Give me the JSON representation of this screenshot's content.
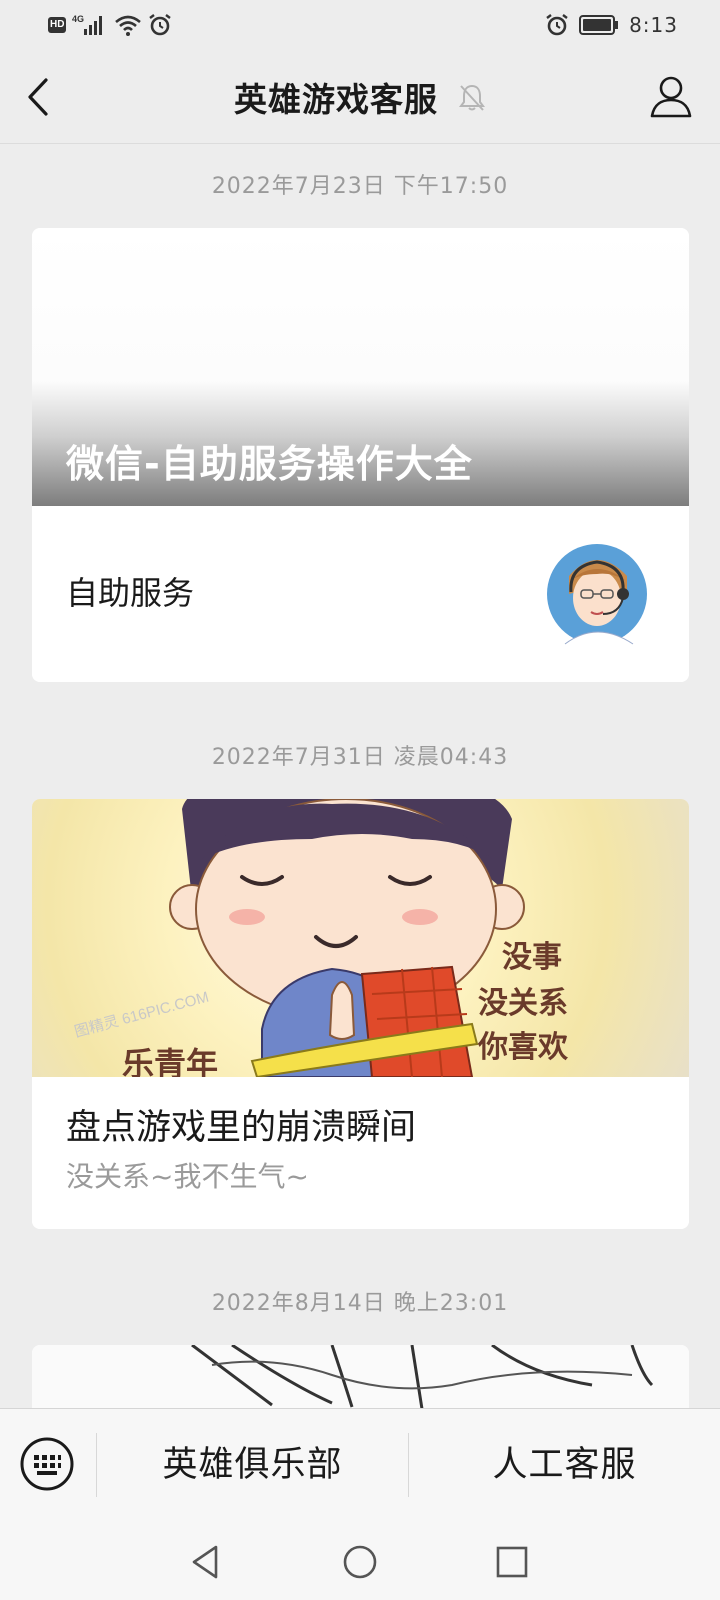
{
  "status_bar": {
    "hd_label": "HD",
    "network_label": "4G",
    "time": "8:13",
    "icons": [
      "hd-icon",
      "signal-icon",
      "wifi-icon",
      "alarm-icon",
      "battery-icon"
    ]
  },
  "header": {
    "title": "英雄游戏客服",
    "icons": [
      "back-icon",
      "mute-bell-icon",
      "profile-icon"
    ]
  },
  "messages": [
    {
      "timestamp": "2022年7月23日 下午17:50",
      "cover_title": "微信-自助服务操作大全",
      "subtitle": "自助服务",
      "thumb": "customer-service-agent-avatar"
    },
    {
      "timestamp": "2022年7月31日 凌晨04:43",
      "title": "盘点游戏里的崩溃瞬间",
      "desc": "没关系~我不生气~",
      "cover_texts": [
        "没事",
        "没关系",
        "你喜欢",
        "乐青年"
      ],
      "watermark": "图精灵 616PIC.COM"
    },
    {
      "timestamp": "2022年8月14日 晚上23:01"
    }
  ],
  "bottom_menu": {
    "items": [
      "英雄俱乐部",
      "人工客服"
    ],
    "keyboard_icon": "keyboard-icon"
  },
  "nav": {
    "icons": [
      "nav-back-icon",
      "nav-home-icon",
      "nav-recents-icon"
    ]
  },
  "colors": {
    "background": "#ededed",
    "card": "#ffffff",
    "timestamp_text": "#9a9a9a"
  }
}
